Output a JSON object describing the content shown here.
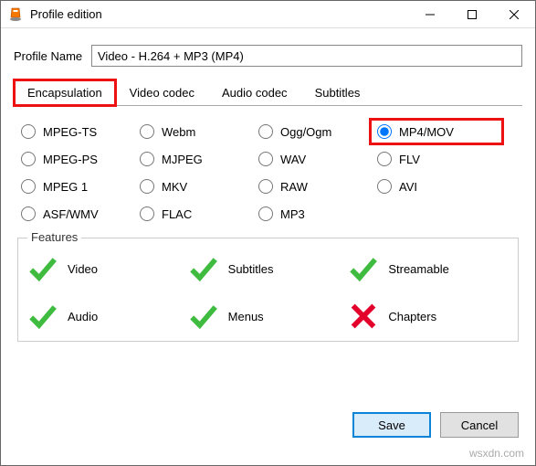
{
  "window": {
    "title": "Profile edition",
    "minimize_tooltip": "Minimize",
    "maximize_tooltip": "Maximize",
    "close_tooltip": "Close"
  },
  "profile": {
    "label": "Profile Name",
    "value": "Video - H.264 + MP3 (MP4)"
  },
  "tabs": {
    "encapsulation": "Encapsulation",
    "video_codec": "Video codec",
    "audio_codec": "Audio codec",
    "subtitles": "Subtitles",
    "active": "encapsulation"
  },
  "formats": {
    "mpeg_ts": "MPEG-TS",
    "webm": "Webm",
    "ogg": "Ogg/Ogm",
    "mp4": "MP4/MOV",
    "mpeg_ps": "MPEG-PS",
    "mjpeg": "MJPEG",
    "wav": "WAV",
    "flv": "FLV",
    "mpeg1": "MPEG 1",
    "mkv": "MKV",
    "raw": "RAW",
    "avi": "AVI",
    "asf": "ASF/WMV",
    "flac": "FLAC",
    "mp3": "MP3",
    "selected": "mp4"
  },
  "features": {
    "legend": "Features",
    "video": {
      "label": "Video",
      "supported": true
    },
    "subtitles": {
      "label": "Subtitles",
      "supported": true
    },
    "streamable": {
      "label": "Streamable",
      "supported": true
    },
    "audio": {
      "label": "Audio",
      "supported": true
    },
    "menus": {
      "label": "Menus",
      "supported": true
    },
    "chapters": {
      "label": "Chapters",
      "supported": false
    }
  },
  "buttons": {
    "save": "Save",
    "cancel": "Cancel"
  },
  "watermark": "wsxdn.com"
}
